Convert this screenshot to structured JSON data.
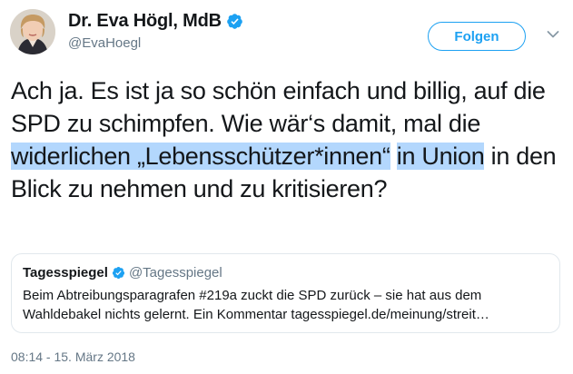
{
  "author": {
    "display_name": "Dr. Eva Högl, MdB",
    "handle": "@EvaHoegl",
    "verified": true
  },
  "follow_button": {
    "label": "Folgen"
  },
  "menu": {
    "icon": "chevron-down-icon"
  },
  "tweet": {
    "text_before": "Ach ja. Es ist ja so schön einfach und billig, auf die SPD zu schimpfen. Wie wär‘s damit, mal die ",
    "highlighted_1": "widerlichen „Lebensschützer*innen“",
    "highlighted_2": "in Union",
    "text_after": " in den Blick zu nehmen und zu kritisieren?"
  },
  "quoted_tweet": {
    "display_name": "Tagesspiegel",
    "handle": "@Tagesspiegel",
    "verified": true,
    "line_1": "Beim Abtreibungsparagrafen #219a zuckt die SPD zurück – sie hat aus dem",
    "line_2": "Wahldebakel nichts gelernt. Ein Kommentar tagesspiegel.de/meinung/streit…"
  },
  "timestamp": "08:14 - 15. März 2018",
  "colors": {
    "accent": "#1da1f2",
    "text": "#14171a",
    "secondary_text": "#657786",
    "highlight": "#b3d7fd",
    "border": "#e1e8ed"
  }
}
